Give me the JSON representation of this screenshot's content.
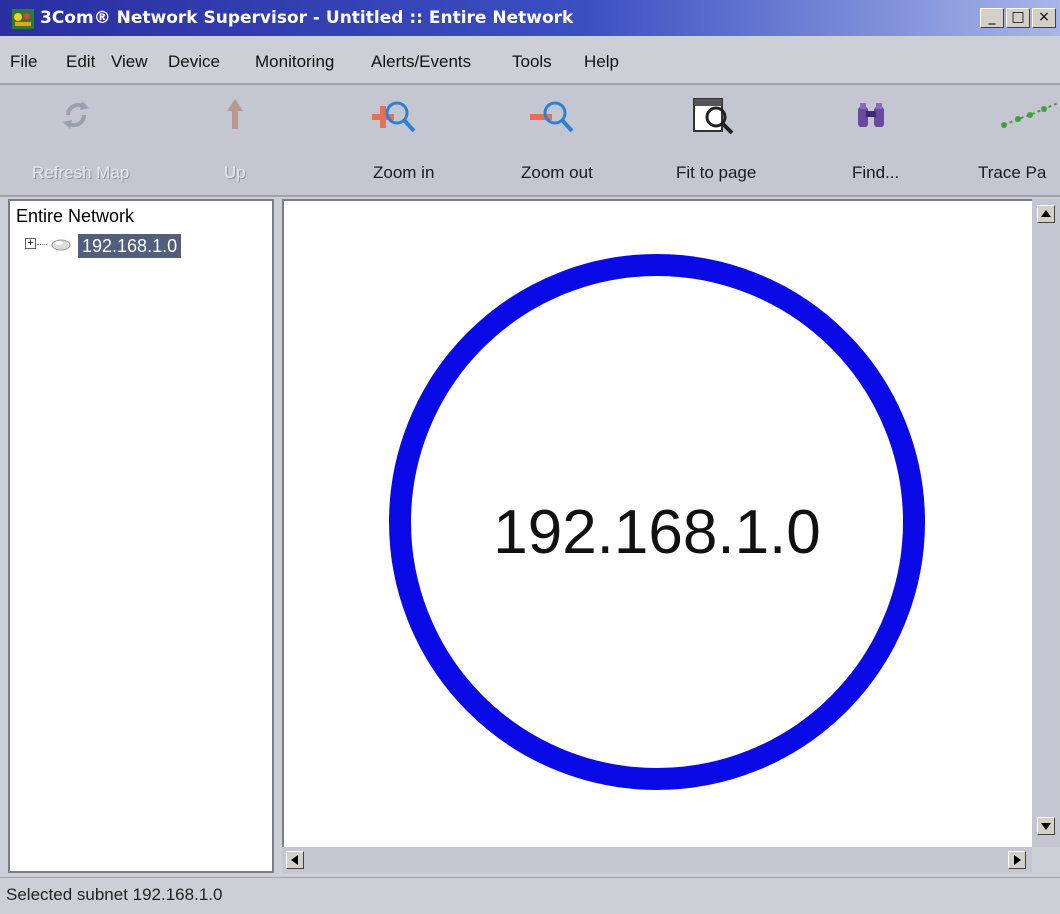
{
  "window": {
    "title": "3Com® Network Supervisor - Untitled :: Entire Network",
    "controls": {
      "minimize": "_",
      "maximize": "□",
      "close": "×"
    }
  },
  "menu": {
    "items": [
      {
        "label": "File",
        "icon": ""
      },
      {
        "label": "Edit"
      },
      {
        "label": "View"
      },
      {
        "label": "Device"
      },
      {
        "label": "Monitoring"
      },
      {
        "label": "Alerts/Events"
      },
      {
        "label": "Tools"
      },
      {
        "label": "Help"
      }
    ]
  },
  "toolbar": {
    "buttons": [
      {
        "label": "Refresh Map",
        "icon": "refresh-icon",
        "enabled": false
      },
      {
        "label": "Up",
        "icon": "up-arrow-icon",
        "enabled": false
      },
      {
        "label": "Zoom in",
        "icon": "zoom-in-icon",
        "enabled": true
      },
      {
        "label": "Zoom out",
        "icon": "zoom-out-icon",
        "enabled": true
      },
      {
        "label": "Fit to page",
        "icon": "fit-to-page-icon",
        "enabled": true
      },
      {
        "label": "Find...",
        "icon": "find-binoculars-icon",
        "enabled": true
      },
      {
        "label": "Trace Pa",
        "icon": "trace-path-icon",
        "enabled": true
      }
    ]
  },
  "tree": {
    "root": "Entire Network",
    "nodes": [
      {
        "label": "192.168.1.0",
        "icon": "subnet-icon",
        "selected": true,
        "expander": "+"
      }
    ]
  },
  "map": {
    "subnet_label": "192.168.1.0",
    "ring_color": "#0a0ae6"
  },
  "status": {
    "text": "Selected subnet 192.168.1.0"
  },
  "colors": {
    "title_bar": "#2a2fa0",
    "selection": "#525e7e",
    "chrome": "#cdcfd6"
  }
}
